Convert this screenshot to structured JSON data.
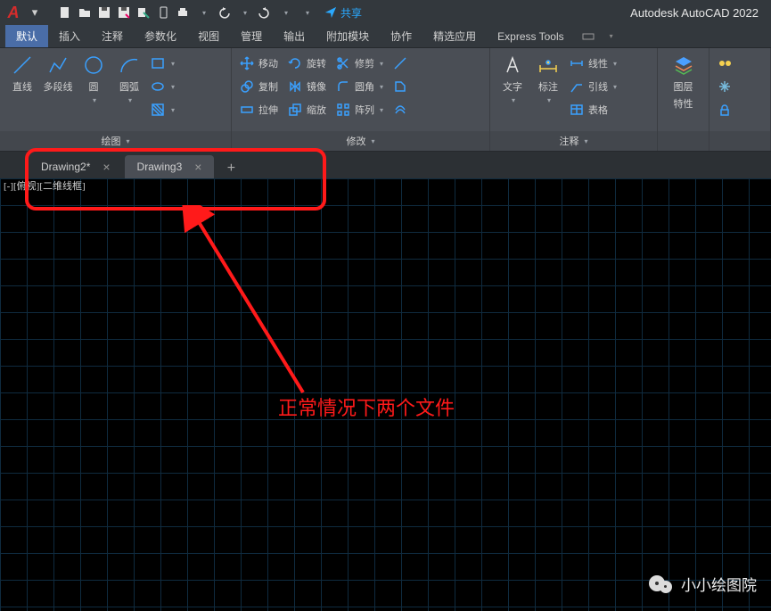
{
  "app": {
    "title": "Autodesk AutoCAD 2022",
    "share_label": "共享"
  },
  "ribbon_tabs": [
    "默认",
    "插入",
    "注释",
    "参数化",
    "视图",
    "管理",
    "输出",
    "附加模块",
    "协作",
    "精选应用",
    "Express Tools"
  ],
  "active_tab": 0,
  "draw_panel": {
    "title": "绘图",
    "line": "直线",
    "polyline": "多段线",
    "circle": "圆",
    "arc": "圆弧"
  },
  "modify_panel": {
    "title": "修改",
    "move": "移动",
    "rotate": "旋转",
    "trim": "修剪",
    "copy": "复制",
    "mirror": "镜像",
    "fillet": "圆角",
    "stretch": "拉伸",
    "scale": "缩放",
    "array": "阵列"
  },
  "annotate_panel": {
    "title": "注释",
    "text": "文字",
    "dim": "标注",
    "linear": "线性",
    "leader": "引线",
    "table": "表格"
  },
  "layers_panel": {
    "title": "图层",
    "props": "特性"
  },
  "file_tabs": [
    {
      "name": "Drawing2*",
      "active": false
    },
    {
      "name": "Drawing3",
      "active": true
    }
  ],
  "viewport_label": "[-][俯视][二维线框]",
  "annotation_text": "正常情况下两个文件",
  "watermark": "小小绘图院"
}
